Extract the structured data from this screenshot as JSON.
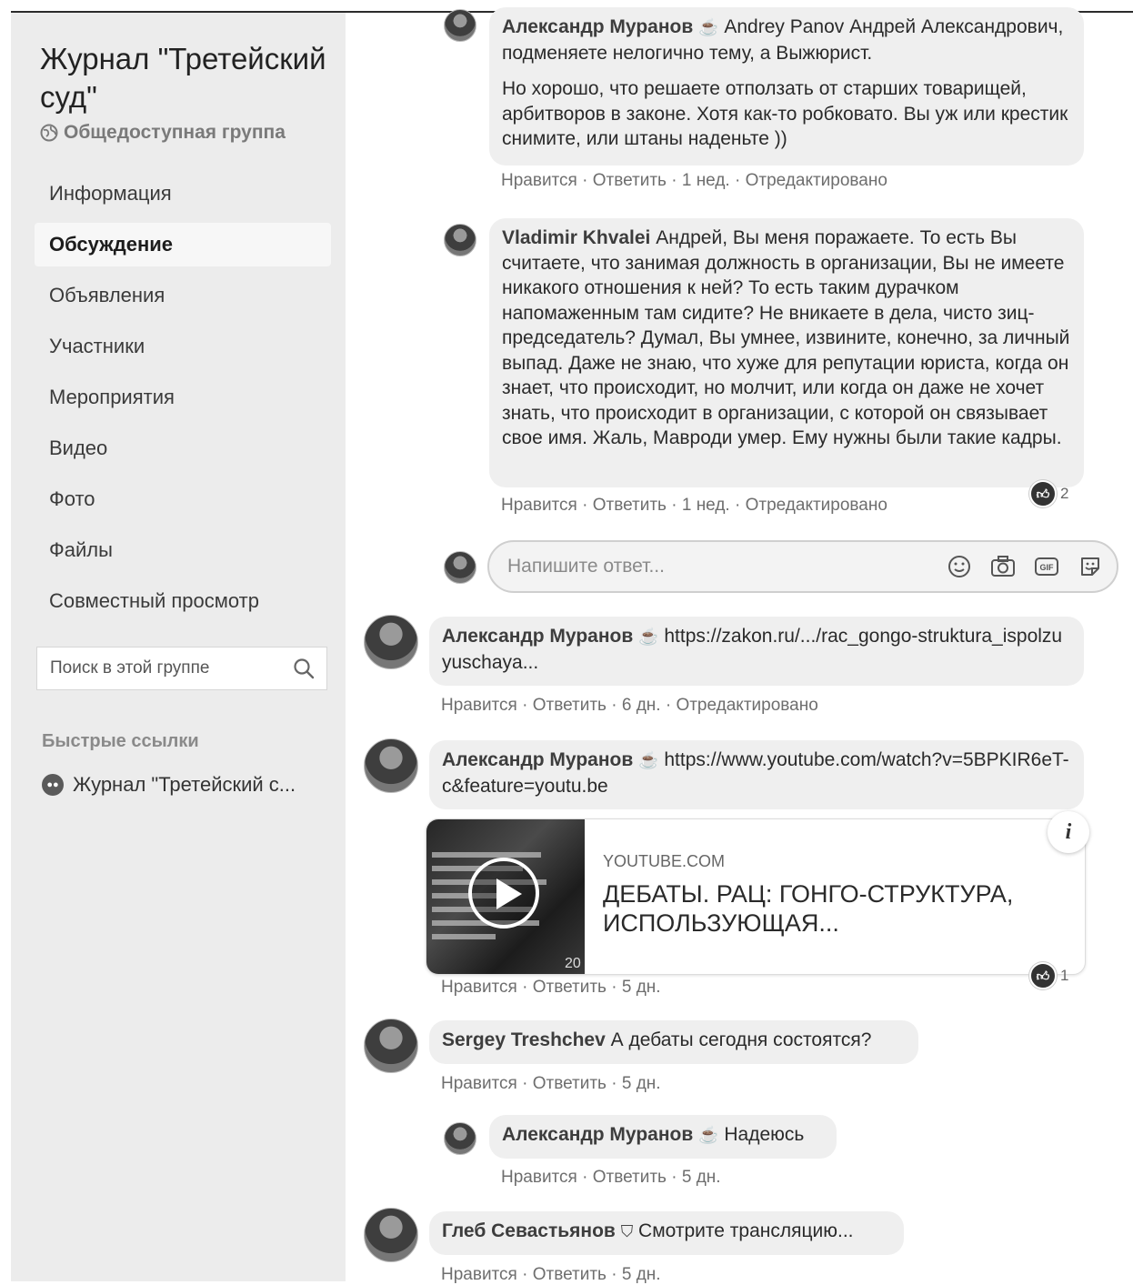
{
  "sidebar": {
    "group_name": "Журнал \"Третейский суд\"",
    "privacy": "Общедоступная группа",
    "nav": [
      {
        "label": "Информация",
        "active": false
      },
      {
        "label": "Обсуждение",
        "active": true
      },
      {
        "label": "Объявления",
        "active": false
      },
      {
        "label": "Участники",
        "active": false
      },
      {
        "label": "Мероприятия",
        "active": false
      },
      {
        "label": "Видео",
        "active": false
      },
      {
        "label": "Фото",
        "active": false
      },
      {
        "label": "Файлы",
        "active": false
      },
      {
        "label": "Совместный просмотр",
        "active": false
      }
    ],
    "search_placeholder": "Поиск в этой группе",
    "quick_links_title": "Быстрые ссылки",
    "quick_link": "Журнал \"Третейский с..."
  },
  "actions": {
    "like": "Нравится",
    "reply": "Ответить",
    "edited": "Отредактировано",
    "sep": "·"
  },
  "comments": [
    {
      "author": "Александр Муранов",
      "text_p1": "Andrey Panov Андрей Александрович, подменяете нелогично тему, а Выжюрист.",
      "text_p2": "Но хорошо, что решаете отползать от старших товарищей, арбитворов в законе. Хотя как-то робковато. Вы уж или крестик снимите, или штаны наденьте ))",
      "time": "1 нед."
    },
    {
      "author": "Vladimir Khvalei",
      "text": "Андрей, Вы меня поражаете. То есть Вы считаете, что занимая должность в организации, Вы не имеете никакого отношения к ней? То есть таким дурачком напомаженным там сидите? Не вникаете в дела, чисто зиц-председатель? Думал, Вы умнее, извините, конечно, за личный выпад. Даже не знаю, что хуже для репутации юриста, когда он знает, что происходит, но молчит, или когда он даже не хочет знать, что происходит в организации, с которой он связывает свое имя. Жаль, Мавроди умер. Ему нужны были такие кадры.",
      "time": "1 нед.",
      "reactions": "2"
    },
    {
      "author": "Александр Муранов",
      "text": "https://zakon.ru/.../rac_gongo-struktura_ispolzuyuschaya...",
      "time": "6 дн."
    },
    {
      "author": "Александр Муранов",
      "text": "https://www.youtube.com/watch?v=5BPKIR6eT-c&feature=youtu.be",
      "time": "5 дн.",
      "reactions": "1",
      "preview": {
        "domain": "YOUTUBE.COM",
        "title": "ДЕБАТЫ. РАЦ: ГОНГО-СТРУКТУРА, ИСПОЛЬЗУЮЩАЯ...",
        "thumb_number": "20"
      }
    },
    {
      "author": "Sergey Treshchev",
      "text": "А дебаты сегодня состоятся?",
      "time": "5 дн."
    },
    {
      "author": "Александр Муранов",
      "text": "Надеюсь",
      "time": "5 дн."
    },
    {
      "author": "Глеб Севастьянов",
      "text": "Смотрите трансляцию...",
      "time": "5 дн."
    }
  ],
  "reply_box": {
    "placeholder": "Напишите ответ..."
  },
  "icons": [
    "globe-icon",
    "search-icon",
    "group-icon",
    "coffee-cup-icon",
    "like-reaction-icon",
    "emoji-icon",
    "camera-icon",
    "gif-icon",
    "sticker-icon",
    "play-icon",
    "info-icon"
  ]
}
